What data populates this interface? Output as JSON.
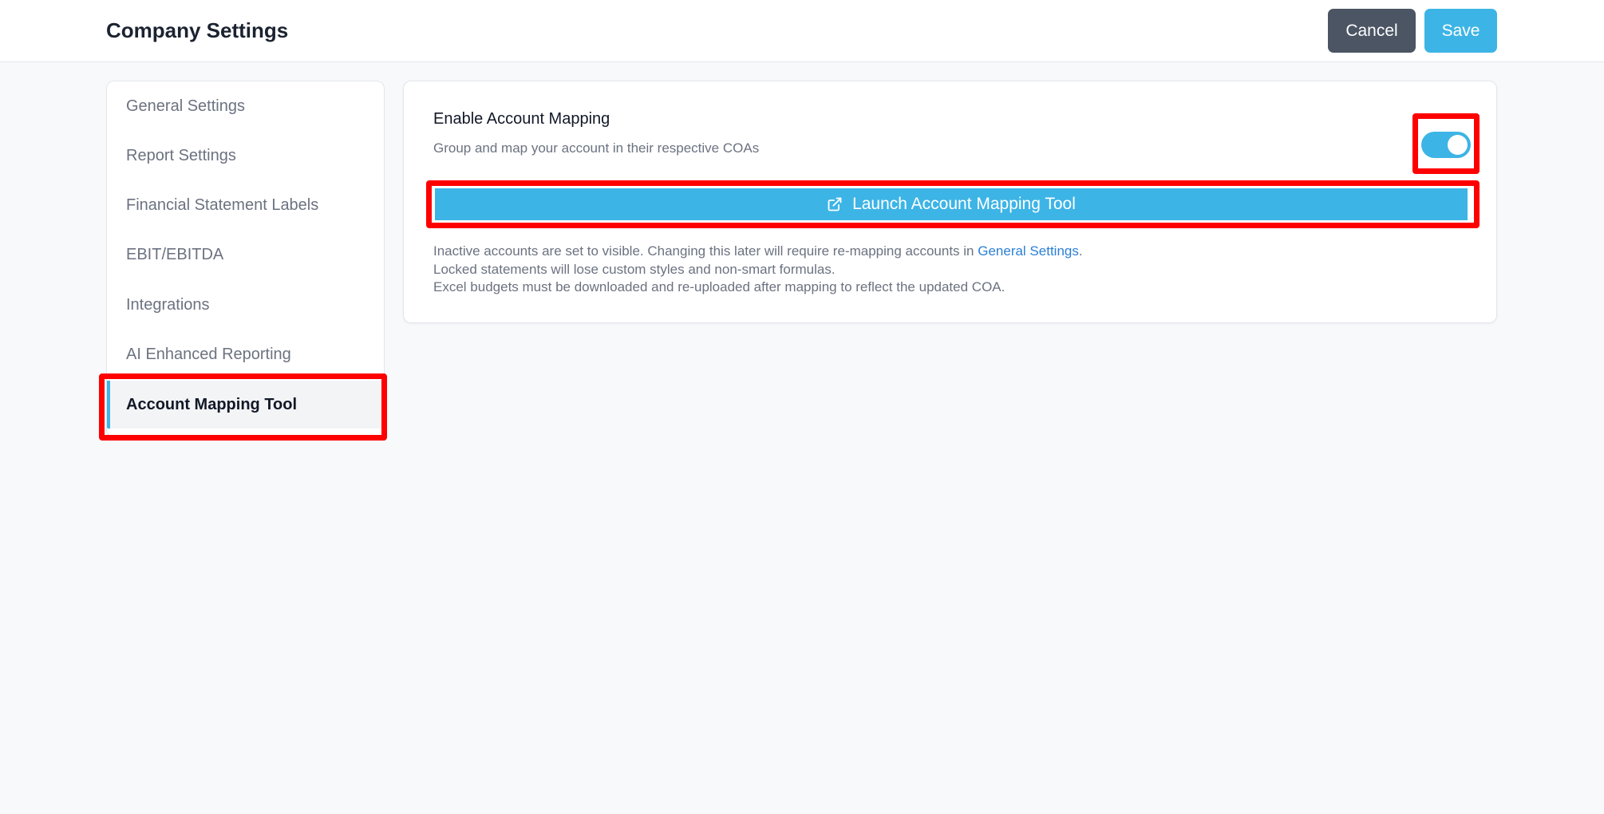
{
  "header": {
    "title": "Company Settings",
    "cancel_label": "Cancel",
    "save_label": "Save"
  },
  "sidebar": {
    "items": [
      {
        "label": "General Settings",
        "active": false
      },
      {
        "label": "Report Settings",
        "active": false
      },
      {
        "label": "Financial Statement Labels",
        "active": false
      },
      {
        "label": "EBIT/EBITDA",
        "active": false
      },
      {
        "label": "Integrations",
        "active": false
      },
      {
        "label": "AI Enhanced Reporting",
        "active": false
      },
      {
        "label": "Account Mapping Tool",
        "active": true
      }
    ]
  },
  "main": {
    "setting_title": "Enable Account Mapping",
    "setting_description": "Group and map your account in their respective COAs",
    "toggle_on": true,
    "launch_button_label": "Launch Account Mapping Tool",
    "launch_button_icon": "external-link-icon",
    "notes": {
      "line1_prefix": "Inactive accounts are set to visible. Changing this later will require re-mapping accounts in ",
      "line1_link": "General Settings",
      "line1_suffix": ".",
      "line2": "Locked statements will lose custom styles and non-smart formulas.",
      "line3": "Excel budgets must be downloaded and re-uploaded after mapping to reflect the updated COA."
    }
  },
  "colors": {
    "accent": "#3db4e6",
    "cancel_button": "#4b5563",
    "link": "#2b7fd6",
    "highlight": "#ff0000",
    "background": "#f8f9fb"
  }
}
